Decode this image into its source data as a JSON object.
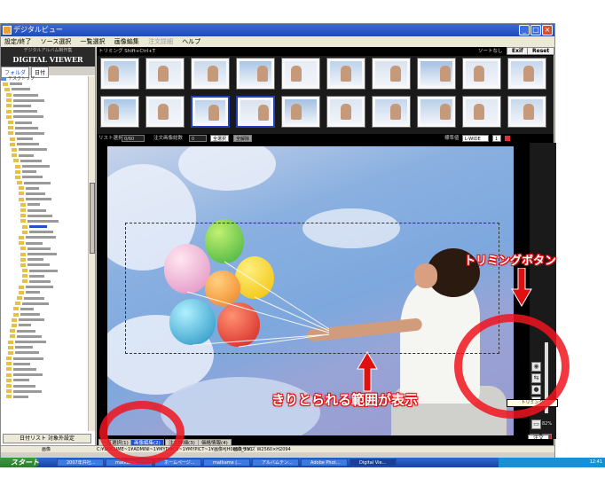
{
  "window": {
    "title": "デジタルビュー",
    "menu": [
      "設定/終了",
      "ソース選択",
      "一覧選択",
      "画像編集",
      "注文詳細",
      "ヘルプ"
    ]
  },
  "left_panel": {
    "brand_sub": "デジタルアルバム制作集",
    "brand": "DIGITAL VIEWER",
    "tabs": [
      "フォルダ",
      "日付"
    ],
    "tree_root": "デスクトップ",
    "bottom_button": "日付リスト 対象外設定"
  },
  "thumb_header": {
    "label": "トリミング Shift+Ctrl+T",
    "sort_label": "ソートなし",
    "exif_button": "Exif",
    "reset_button": "Reset"
  },
  "info_bar": {
    "list_label": "リスト選択",
    "list_value": "0/60",
    "order_label": "注文画像総数",
    "order_value": "0",
    "select_all": "全選択",
    "deselect": "全解除",
    "standard_label": "標準値",
    "size_value": "L-WIDE",
    "qty_value": "1"
  },
  "tooltip": "トリミング Shift+Ctrl+T",
  "zoom": "82%",
  "order_button": "注文",
  "tabs": [
    "一覧選択(1)",
    "画像編集(2)",
    "注文詳細(3)",
    "価格情報(4)"
  ],
  "active_tab": 1,
  "status": {
    "label": "画像",
    "path": "C:¥DOCUME~1¥ADMINI~1¥MYDOCU~1¥MYPICT~1¥画像¥JH0653_350",
    "size": "画像サイズ W2560×H2094"
  },
  "taskbar": {
    "start": "スタート",
    "tasks": [
      "2007年弁社...",
      "matkame...",
      "ホームページ...",
      "matkame (...",
      "アルバムテン...",
      "Adobe Phot...",
      "Digital Vie..."
    ],
    "active_task": 6,
    "clock": "12:41"
  },
  "annotations": {
    "trim_button": "トリミングボタン",
    "crop_range": "きりとられる範囲が表示"
  }
}
